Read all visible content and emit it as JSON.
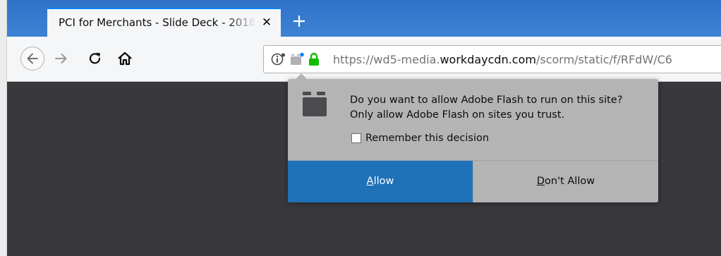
{
  "tab": {
    "title": "PCI for Merchants - Slide Deck - 2018",
    "close_icon": "close-icon",
    "new_tab_icon": "plus-icon"
  },
  "toolbar": {
    "back_icon": "back-arrow-icon",
    "forward_icon": "forward-arrow-icon",
    "reload_icon": "reload-icon",
    "home_icon": "home-icon"
  },
  "urlbar": {
    "prefix": "https://wd5-media.",
    "domain": "workdaycdn.com",
    "path": "/scorm/static/f/RFdW/C6",
    "icons": [
      "info-icon",
      "plugin-icon",
      "lock-icon"
    ],
    "lock_color": "#12bc00"
  },
  "popup": {
    "message_line1": "Do you want to allow Adobe Flash to run on this site?",
    "message_line2": "Only allow Adobe Flash on sites you trust.",
    "remember_label": "Remember this decision",
    "remember_checked": false,
    "allow_label_access": "A",
    "allow_label_rest": "llow",
    "deny_label_access": "D",
    "deny_label_rest": "on't Allow",
    "accent_color": "#1f72b8"
  }
}
